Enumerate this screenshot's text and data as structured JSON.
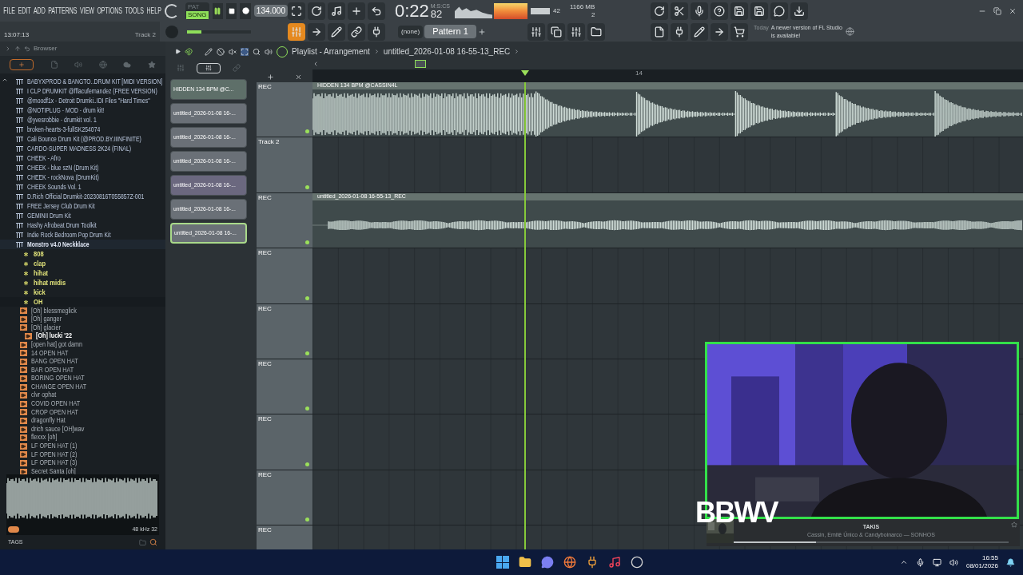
{
  "menu": [
    "FILE",
    "EDIT",
    "ADD",
    "PATTERNS",
    "VIEW",
    "OPTIONS",
    "TOOLS",
    "HELP"
  ],
  "transport": {
    "modes": [
      {
        "label": "PAT",
        "selected": false
      },
      {
        "label": "SONG",
        "selected": true
      }
    ],
    "tempo": "134.000"
  },
  "time": {
    "main": "0:22",
    "fraction": "82",
    "unit": "M:S:CS"
  },
  "status": {
    "time": "13:07:13",
    "hint": "Track 2"
  },
  "monitor": {
    "cpu": "42",
    "memory": "1166 MB",
    "voices": "2"
  },
  "master_pitch": {
    "level": 0.22
  },
  "snap": "(none)",
  "pattern": "Pattern 1",
  "news": {
    "when": "Today",
    "message": "A newer version of FL Studio is available!"
  },
  "browser": {
    "title": "Browser",
    "items": [
      {
        "name": "BABYXPROD & BANGTO..DRUM KIT [MIDI VERSION]",
        "kind": "folder",
        "expanded": false
      },
      {
        "name": "I CLP DRUMKIT @fflacufernandez (FREE VERSION)",
        "kind": "folder",
        "expanded": false
      },
      {
        "name": "@moodf1x - Detroit Drumki..IDI Files \"Hard Times\"",
        "kind": "folder",
        "expanded": false
      },
      {
        "name": "@NOTIPLUG - MOD - drum kit!",
        "kind": "folder",
        "expanded": false
      },
      {
        "name": "@yvesrobbie - drumkit vol. 1",
        "kind": "folder",
        "expanded": false
      },
      {
        "name": "broken-hearts-3-fullSK254074",
        "kind": "folder",
        "expanded": false
      },
      {
        "name": "Cali Bounce Drum Kit (@PROD.BY.IIINFINITE)",
        "kind": "folder",
        "expanded": false
      },
      {
        "name": "CARDO-SUPER MADNESS 2K24 (FINAL)",
        "kind": "folder",
        "expanded": false
      },
      {
        "name": "CHEEK - Afro",
        "kind": "folder",
        "expanded": false
      },
      {
        "name": "CHEEK - blue szN (Drum Kit)",
        "kind": "folder",
        "expanded": false
      },
      {
        "name": "CHEEK - rockNova (DrumKit)",
        "kind": "folder",
        "expanded": false
      },
      {
        "name": "CHEEK Sounds Vol. 1",
        "kind": "folder",
        "expanded": false
      },
      {
        "name": "D.Rich Official Drumkit-20230816T055857Z-001",
        "kind": "folder",
        "expanded": false
      },
      {
        "name": "FREE Jersey Club Drum Kit",
        "kind": "folder",
        "expanded": false
      },
      {
        "name": "GEMINII Drum Kit",
        "kind": "folder",
        "expanded": false
      },
      {
        "name": "Hashy Afrobeat Drum Toolkit",
        "kind": "folder",
        "expanded": false
      },
      {
        "name": "Indie Rock Bedroom Pop Drum Kit",
        "kind": "folder",
        "expanded": false
      },
      {
        "name": "Monstro v4.0 Neckklace",
        "kind": "folder",
        "expanded": true,
        "children": [
          {
            "name": "808",
            "kind": "category",
            "expanded": false
          },
          {
            "name": "clap",
            "kind": "category",
            "expanded": false
          },
          {
            "name": "hihat",
            "kind": "category",
            "expanded": false
          },
          {
            "name": "hihat midis",
            "kind": "category",
            "expanded": false
          },
          {
            "name": "kick",
            "kind": "category",
            "expanded": false
          },
          {
            "name": "OH",
            "kind": "category",
            "expanded": true,
            "children": [
              {
                "name": "[Oh] blessmeglick",
                "kind": "sample",
                "selected": false
              },
              {
                "name": "[Oh] ganger",
                "kind": "sample",
                "selected": false
              },
              {
                "name": "[Oh] glacier",
                "kind": "sample",
                "selected": false
              },
              {
                "name": "[Oh] lucki '22",
                "kind": "sample",
                "selected": true
              },
              {
                "name": "[open hat] got damn",
                "kind": "sample",
                "selected": false
              },
              {
                "name": "14 OPEN HAT",
                "kind": "sample",
                "selected": false
              },
              {
                "name": "BANG OPEN HAT",
                "kind": "sample",
                "selected": false
              },
              {
                "name": "BAR OPEN HAT",
                "kind": "sample",
                "selected": false
              },
              {
                "name": "BORING OPEN HAT",
                "kind": "sample",
                "selected": false
              },
              {
                "name": "CHANGE OPEN HAT",
                "kind": "sample",
                "selected": false
              },
              {
                "name": "clvr ophat",
                "kind": "sample",
                "selected": false
              },
              {
                "name": "COVID OPEN HAT",
                "kind": "sample",
                "selected": false
              },
              {
                "name": "CROP OPEN HAT",
                "kind": "sample",
                "selected": false
              },
              {
                "name": "dragonfly Hat",
                "kind": "sample",
                "selected": false
              },
              {
                "name": "drich sauce [OH]wav",
                "kind": "sample",
                "selected": false
              },
              {
                "name": "flexxx [oh]",
                "kind": "sample",
                "selected": false
              },
              {
                "name": "LF OPEN HAT (1)",
                "kind": "sample",
                "selected": false
              },
              {
                "name": "LF OPEN HAT (2)",
                "kind": "sample",
                "selected": false
              },
              {
                "name": "LF OPEN HAT (3)",
                "kind": "sample",
                "selected": false
              },
              {
                "name": "Secret Santa [oh]",
                "kind": "sample",
                "selected": false
              }
            ]
          }
        ]
      }
    ],
    "sample": "48 kHz 32",
    "tags": "TAGS"
  },
  "playlist": {
    "title": "Playlist - Arrangement",
    "clip_name": "untitled_2026-01-08 16-55-13_REC",
    "ruler": [
      "14"
    ],
    "patterns": [
      {
        "name": "HIDDEN 134 BPM @C...",
        "color": "#5e6f69",
        "selected": false
      },
      {
        "name": "untitled_2026-01-08 16-...",
        "color": "#6a7077",
        "selected": false
      },
      {
        "name": "untitled_2026-01-08 16-...",
        "color": "#6a7077",
        "selected": false
      },
      {
        "name": "untitled_2026-01-08 16-...",
        "color": "#6a7077",
        "selected": false
      },
      {
        "name": "untitled_2026-01-08 16-...",
        "color": "#6b687f",
        "selected": false
      },
      {
        "name": "untitled_2026-01-08 16-...",
        "color": "#6a7077",
        "selected": false
      },
      {
        "name": "untitled_2026-01-08 16-...",
        "color": "#6a7077",
        "selected": true
      }
    ],
    "tracks": [
      {
        "name": "REC",
        "clip": "HIDDEN 134 BPM @CASSIN4L"
      },
      {
        "name": "Track 2"
      },
      {
        "name": "REC",
        "clip": "untitled_2026-01-08 16-55-13_REC"
      },
      {
        "name": "REC"
      },
      {
        "name": "REC"
      },
      {
        "name": "REC"
      },
      {
        "name": "REC"
      },
      {
        "name": "REC"
      },
      {
        "name": "REC"
      }
    ]
  },
  "overlay": {
    "logo": "BBWV",
    "song": "TAKIS",
    "artists": "Cassin, Emitê Único & Candyboinarco — SONHOS",
    "level": 0.3
  },
  "taskbar": {
    "time": "16:55",
    "date": "08/01/2026"
  }
}
